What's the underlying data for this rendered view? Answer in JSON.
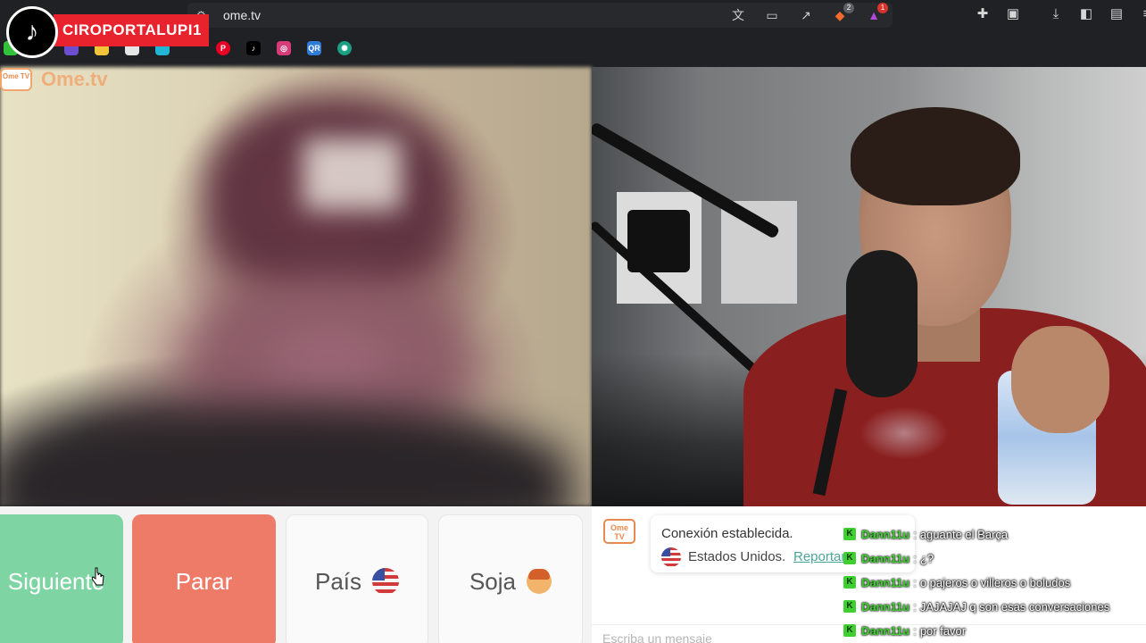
{
  "browser": {
    "url": "ome.tv",
    "bookmarks": [
      "pinterest-icon",
      "tiktok-icon",
      "instagram-icon",
      "qr-icon",
      "chatgpt-icon"
    ],
    "extensions": {
      "brave_shield_count": "2",
      "notification_count": "1"
    }
  },
  "overlay": {
    "tiktok_username": "CIROPORTALUPI1"
  },
  "ometv": {
    "logo_box": "Ome TV",
    "logo_text": "Ome.tv"
  },
  "controls": {
    "next_label": "Siguiente",
    "stop_label": "Parar",
    "country_label": "País",
    "gender_label": "Soja"
  },
  "chat": {
    "logo_box": "Ome TV",
    "connection_text": "Conexión establecida.",
    "country": "Estados Unidos.",
    "report_link": "Reportar",
    "input_placeholder": "Escriba un mensaje"
  },
  "live_comments": [
    {
      "user": "Dann11u",
      "text": "aguante el Barça"
    },
    {
      "user": "Dann11u",
      "text": "¿?"
    },
    {
      "user": "Dann11u",
      "text": "o pajeros o villeros o boludos"
    },
    {
      "user": "Dann11u",
      "text": "JAJAJAJ q son esas conversaciones"
    },
    {
      "user": "Dann11u",
      "text": "por favor"
    }
  ],
  "colors": {
    "next_button": "#7fd4a4",
    "stop_button": "#ee7b68",
    "accent_orange": "#e88a50",
    "kick_green": "#3fcf30",
    "tiktok_red": "#e8232d"
  }
}
